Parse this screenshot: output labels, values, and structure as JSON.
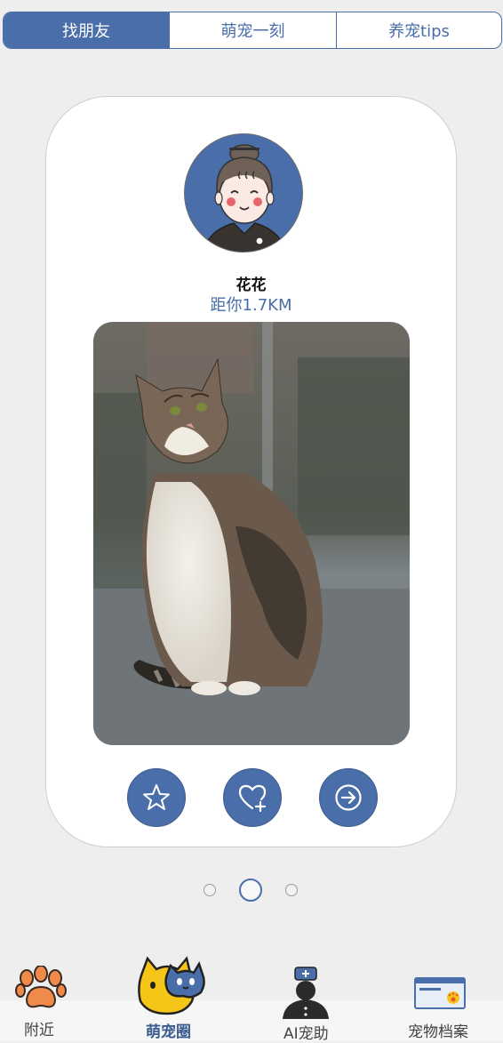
{
  "tabs": [
    "找朋友",
    "萌宠一刻",
    "养宠tips"
  ],
  "profile": {
    "name": "花花",
    "distance": "距你1.7KM"
  },
  "actions": [
    "star-icon",
    "heart-plus-icon",
    "arrow-right-circle-icon"
  ],
  "pagination": {
    "total": 3,
    "current": 2
  },
  "nav": {
    "items": [
      {
        "label": "附近",
        "icon": "paw-icon"
      },
      {
        "label": "萌宠圈",
        "icon": "cat-dog-icon"
      },
      {
        "label": "AI宠助",
        "icon": "vet-doctor-icon"
      },
      {
        "label": "宠物档案",
        "icon": "pet-id-card-icon"
      }
    ]
  },
  "colors": {
    "accent": "#4a6ea9",
    "background": "#eeeeee"
  }
}
